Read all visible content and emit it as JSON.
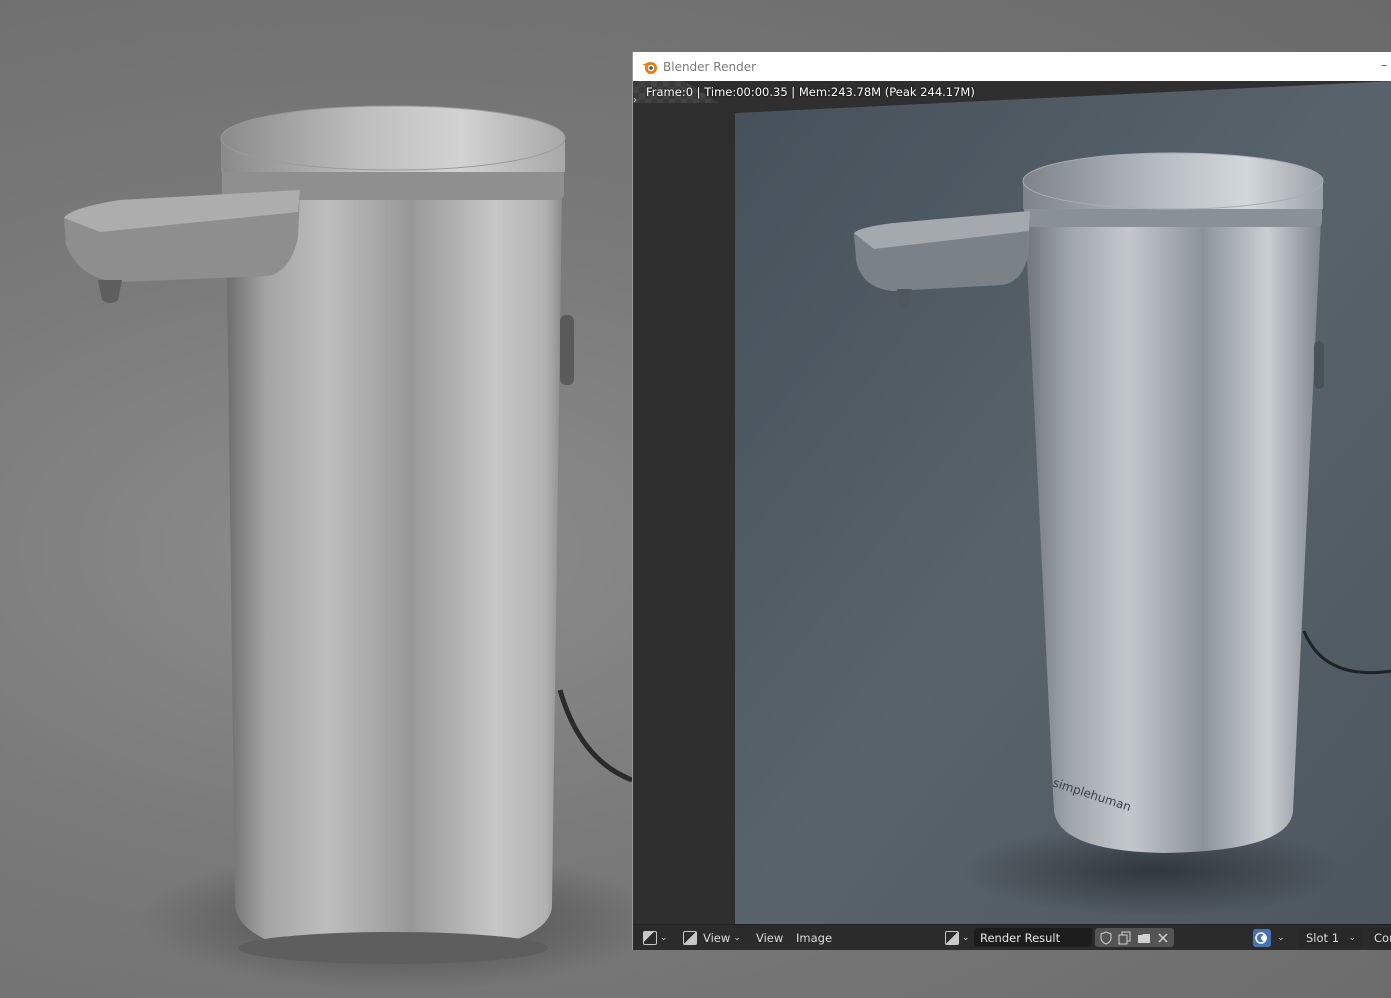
{
  "window": {
    "title": "Blender Render",
    "minimize_glyph": "–"
  },
  "render": {
    "status": "Frame:0 | Time:00:00.35 | Mem:243.78M (Peak 244.17M)",
    "brand_text": "simplehuman"
  },
  "footer": {
    "view_menu_label": "View",
    "view_label": "View",
    "image_label": "Image",
    "image_name": "Render Result",
    "slot": "Slot 1",
    "composite": "Com"
  },
  "colors": {
    "viewport_bg": "#7a7a7a",
    "render_bg": "#4d565d",
    "window_header": "#2b2b2b",
    "title_bar": "#ffffff",
    "blender_orange": "#e87d0d",
    "active_blue": "#4772b3"
  },
  "icons": [
    "blender-logo-icon",
    "panel-toggle-icon",
    "image-editor-icon",
    "view-mode-icon",
    "image-pick-icon",
    "fake-user-shield-icon",
    "new-image-icon",
    "open-folder-icon",
    "unlink-x-icon",
    "overlay-icon",
    "chevron-down-icon"
  ]
}
